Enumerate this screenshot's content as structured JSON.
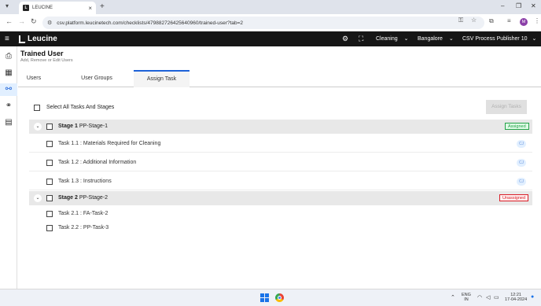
{
  "browser": {
    "tab_title": "LEUCINE",
    "url": "csv.platform.leucinetech.com/checklists/479882726425640960/trained-user?tab=2"
  },
  "app": {
    "brand": "Leucine",
    "facility": "Cleaning",
    "location": "Bangalore",
    "user_role": "CSV Process Publisher 10"
  },
  "page": {
    "title": "Trained User",
    "subtitle": "Add, Remove or Edit Users",
    "tabs": [
      {
        "label": "Users"
      },
      {
        "label": "User Groups"
      },
      {
        "label": "Assign Task"
      }
    ],
    "select_all_label": "Select All Tasks And Stages",
    "assign_button": "Assign Tasks"
  },
  "stages": [
    {
      "number_label": "Stage 1",
      "name": "PP-Stage-1",
      "status": "Assigned",
      "tasks": [
        {
          "label": "Task 1.1 : Materials Required for Cleaning",
          "chip": "CJ"
        },
        {
          "label": "Task 1.2 : Additional Information",
          "chip": "CJ"
        },
        {
          "label": "Task 1.3 : Instructions",
          "chip": "CJ"
        }
      ]
    },
    {
      "number_label": "Stage 2",
      "name": "PP-Stage-2",
      "status": "Unassigned",
      "tasks": [
        {
          "label": "Task 2.1 : FA-Task-2"
        },
        {
          "label": "Task 2.2 : PP-Task-3"
        }
      ]
    }
  ],
  "taskbar": {
    "lang_top": "ENG",
    "lang_bottom": "IN",
    "time": "12:21",
    "date": "17-04-2024"
  },
  "colors": {
    "accent": "#1d62d8",
    "header_bg": "#161616",
    "assigned": "#24a148",
    "unassigned": "#da1e28"
  }
}
